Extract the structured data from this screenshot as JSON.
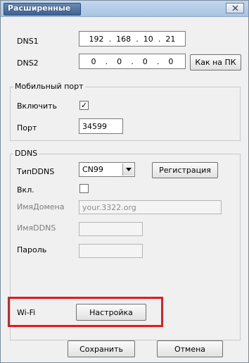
{
  "window": {
    "title": "Расширенные",
    "close_label": "X"
  },
  "dns": {
    "dns1_label": "DNS1",
    "dns1_octets": [
      "192",
      "168",
      "10",
      "21"
    ],
    "dns2_label": "DNS2",
    "dns2_octets": [
      "0",
      "0",
      "0",
      "0"
    ],
    "dot": ".",
    "copy_pc_button": "Как на ПК"
  },
  "mobile_port": {
    "group_label": "Мобильный порт",
    "enable_label": "Включить",
    "enable_checked": true,
    "check_mark": "✓",
    "port_label": "Порт",
    "port_value": "34599"
  },
  "ddns": {
    "group_label": "DDNS",
    "type_label": "ТипDDNS",
    "type_value": "CN99",
    "register_button": "Регистрация",
    "enabled_label": "Вкл.",
    "enabled_checked": false,
    "domain_label": "ИмяДомена",
    "domain_value": "your.3322.org",
    "ddns_name_label": "ИмяDDNS",
    "ddns_name_value": "",
    "password_label": "Пароль",
    "password_value": ""
  },
  "wifi": {
    "label": "Wi-Fi",
    "settings_button": "Настройка",
    "highlight_color": "#e8191a"
  },
  "footer": {
    "save_button": "Сохранить",
    "cancel_button": "Отмена"
  }
}
